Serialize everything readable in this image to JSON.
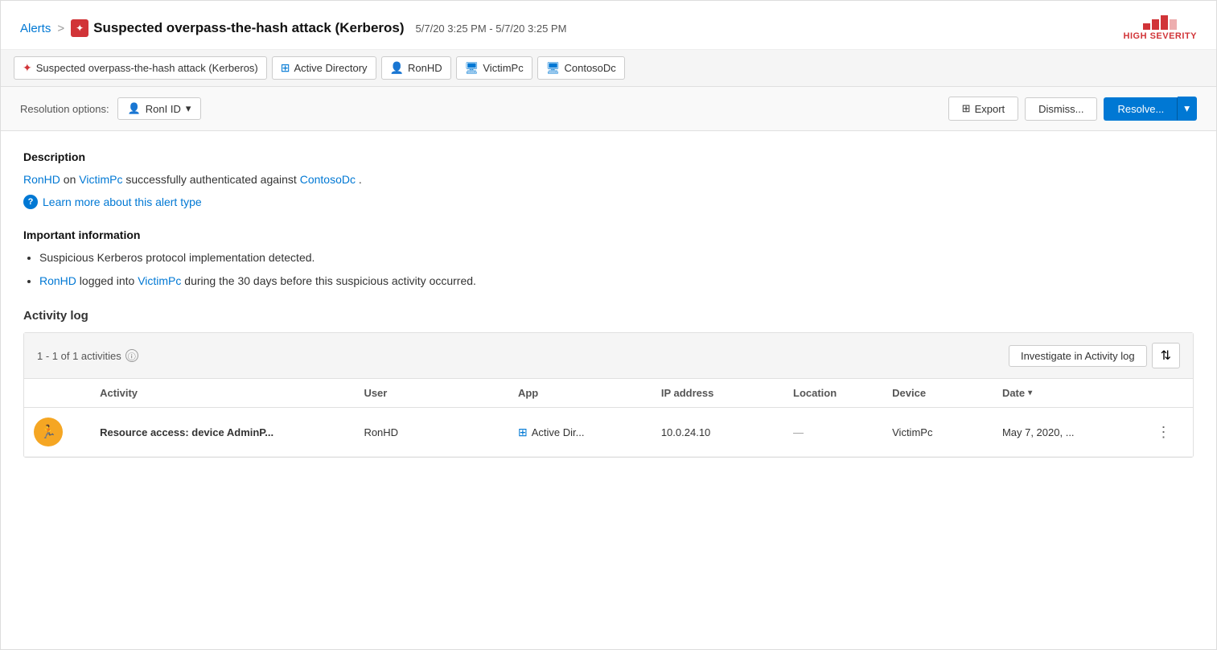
{
  "header": {
    "breadcrumb": "Alerts",
    "sep": ">",
    "title": "Suspected overpass-the-hash attack (Kerberos)",
    "date_range": "5/7/20 3:25 PM - 5/7/20 3:25 PM",
    "severity": "HIGH SEVERITY"
  },
  "tabs": [
    {
      "id": "alert",
      "label": "Suspected overpass-the-hash attack (Kerberos)",
      "icon_type": "alert"
    },
    {
      "id": "ad",
      "label": "Active Directory",
      "icon_type": "ad"
    },
    {
      "id": "ronhd",
      "label": "RonHD",
      "icon_type": "user"
    },
    {
      "id": "victimpc",
      "label": "VictimPc",
      "icon_type": "computer"
    },
    {
      "id": "contosodc",
      "label": "ContosoDc",
      "icon_type": "computer"
    }
  ],
  "resolution": {
    "label": "Resolution options:",
    "dropdown_value": "RonI ID",
    "export_label": "Export",
    "dismiss_label": "Dismiss...",
    "resolve_label": "Resolve..."
  },
  "description": {
    "section_title": "Description",
    "text_before": "RonHD on ",
    "link1": "VictimPc",
    "text_middle": " successfully authenticated against ",
    "link2": "ContosoDc",
    "text_end": ".",
    "learn_more": "Learn more about this alert type"
  },
  "important_info": {
    "section_title": "Important information",
    "bullets": [
      {
        "text": "Suspicious Kerberos protocol implementation detected.",
        "links": []
      },
      {
        "parts": [
          "",
          "RonHD",
          " logged into ",
          "VictimPc",
          " during the 30 days before this suspicious activity occurred."
        ]
      }
    ]
  },
  "activity_log": {
    "section_title": "Activity log",
    "count_text": "1 - 1 of 1 activities",
    "investigate_btn": "Investigate in Activity log",
    "columns": [
      "Activity",
      "User",
      "App",
      "IP address",
      "Location",
      "Device",
      "Date"
    ],
    "rows": [
      {
        "icon": "🏃",
        "activity": "Resource access: device AdminP...",
        "user": "RonHD",
        "app_icon": true,
        "app": "Active Dir...",
        "ip": "10.0.24.10",
        "location": "—",
        "device": "VictimPc",
        "date": "May 7, 2020, ..."
      }
    ]
  }
}
